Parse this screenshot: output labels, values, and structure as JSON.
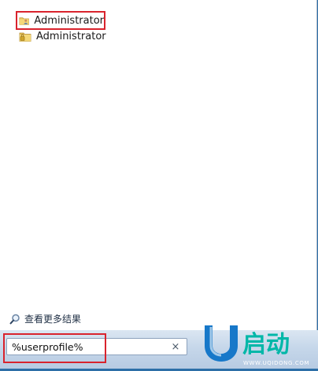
{
  "results": [
    {
      "label": "Administrator",
      "icon": "user-folder-icon",
      "highlighted": true
    },
    {
      "label": "Administrator",
      "icon": "locked-folder-icon",
      "highlighted": false
    }
  ],
  "see_more": {
    "label": "查看更多结果",
    "icon": "magnifier-icon"
  },
  "search": {
    "value": "%userprofile%",
    "clear_icon": "clear-x-icon",
    "clear_glyph": "×"
  },
  "logo": {
    "text": "U启动",
    "url": "WWW.UQIDONG.COM"
  },
  "colors": {
    "highlight_border": "#d9232d",
    "taskbar_blue": "#2d6fa7",
    "logo_teal": "#00b7a8",
    "logo_blue": "#1778c9"
  }
}
